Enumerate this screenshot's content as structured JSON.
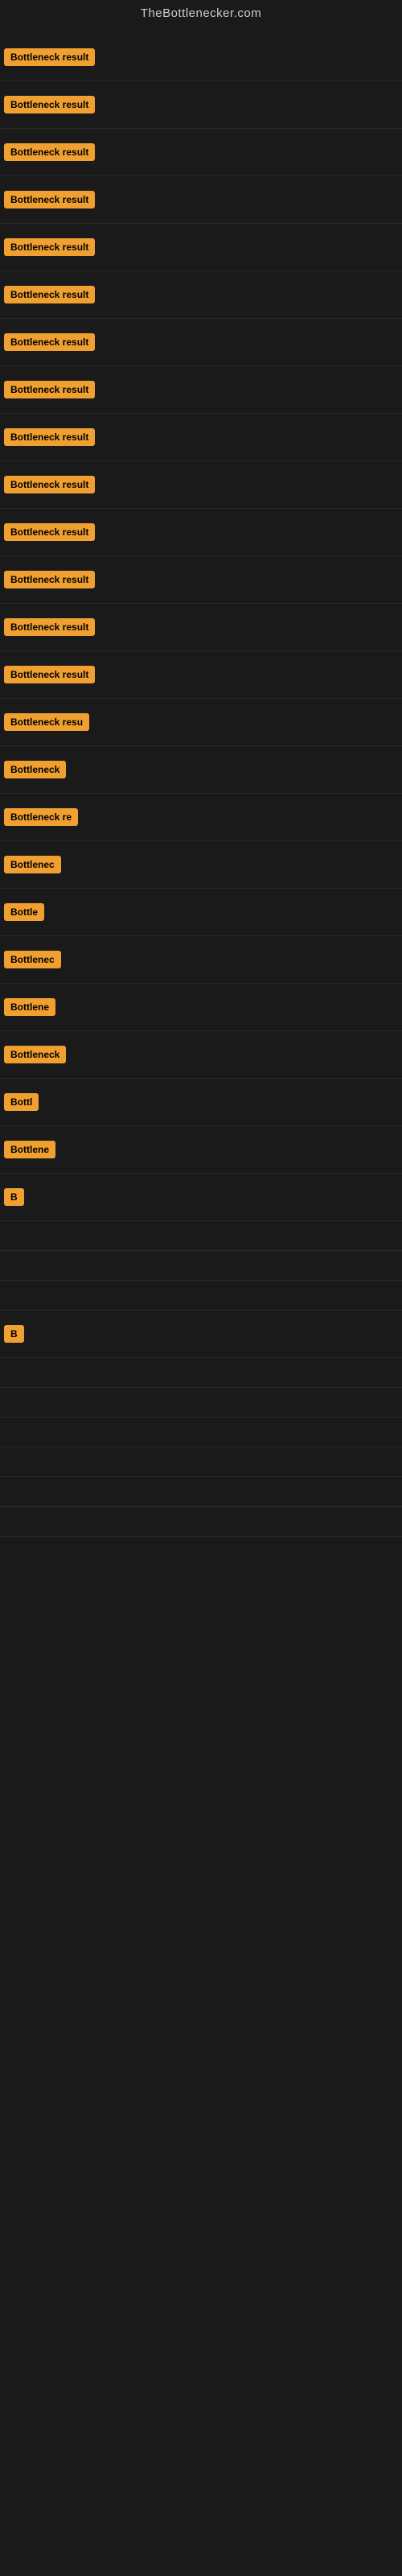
{
  "header": {
    "title": "TheBottlenecker.com"
  },
  "items": [
    {
      "id": 1,
      "label": "Bottleneck result",
      "visible_chars": 16
    },
    {
      "id": 2,
      "label": "Bottleneck result",
      "visible_chars": 16
    },
    {
      "id": 3,
      "label": "Bottleneck result",
      "visible_chars": 16
    },
    {
      "id": 4,
      "label": "Bottleneck result",
      "visible_chars": 16
    },
    {
      "id": 5,
      "label": "Bottleneck result",
      "visible_chars": 16
    },
    {
      "id": 6,
      "label": "Bottleneck result",
      "visible_chars": 16
    },
    {
      "id": 7,
      "label": "Bottleneck result",
      "visible_chars": 16
    },
    {
      "id": 8,
      "label": "Bottleneck result",
      "visible_chars": 16
    },
    {
      "id": 9,
      "label": "Bottleneck result",
      "visible_chars": 16
    },
    {
      "id": 10,
      "label": "Bottleneck result",
      "visible_chars": 16
    },
    {
      "id": 11,
      "label": "Bottleneck result",
      "visible_chars": 16
    },
    {
      "id": 12,
      "label": "Bottleneck result",
      "visible_chars": 16
    },
    {
      "id": 13,
      "label": "Bottleneck result",
      "visible_chars": 16
    },
    {
      "id": 14,
      "label": "Bottleneck result",
      "visible_chars": 16
    },
    {
      "id": 15,
      "label": "Bottleneck resu",
      "visible_chars": 15
    },
    {
      "id": 16,
      "label": "Bottleneck",
      "visible_chars": 10
    },
    {
      "id": 17,
      "label": "Bottleneck re",
      "visible_chars": 13
    },
    {
      "id": 18,
      "label": "Bottlenec",
      "visible_chars": 9
    },
    {
      "id": 19,
      "label": "Bottle",
      "visible_chars": 6
    },
    {
      "id": 20,
      "label": "Bottlenec",
      "visible_chars": 9
    },
    {
      "id": 21,
      "label": "Bottlene",
      "visible_chars": 8
    },
    {
      "id": 22,
      "label": "Bottleneck",
      "visible_chars": 10
    },
    {
      "id": 23,
      "label": "Bottl",
      "visible_chars": 5
    },
    {
      "id": 24,
      "label": "Bottlene",
      "visible_chars": 8
    },
    {
      "id": 25,
      "label": "B",
      "visible_chars": 1
    },
    {
      "id": 26,
      "label": "",
      "visible_chars": 0
    },
    {
      "id": 27,
      "label": "",
      "visible_chars": 0
    },
    {
      "id": 28,
      "label": "",
      "visible_chars": 0
    },
    {
      "id": 29,
      "label": "B",
      "visible_chars": 1
    },
    {
      "id": 30,
      "label": "",
      "visible_chars": 0
    },
    {
      "id": 31,
      "label": "",
      "visible_chars": 0
    },
    {
      "id": 32,
      "label": "",
      "visible_chars": 0
    },
    {
      "id": 33,
      "label": "",
      "visible_chars": 0
    },
    {
      "id": 34,
      "label": "",
      "visible_chars": 0
    },
    {
      "id": 35,
      "label": "",
      "visible_chars": 0
    }
  ]
}
